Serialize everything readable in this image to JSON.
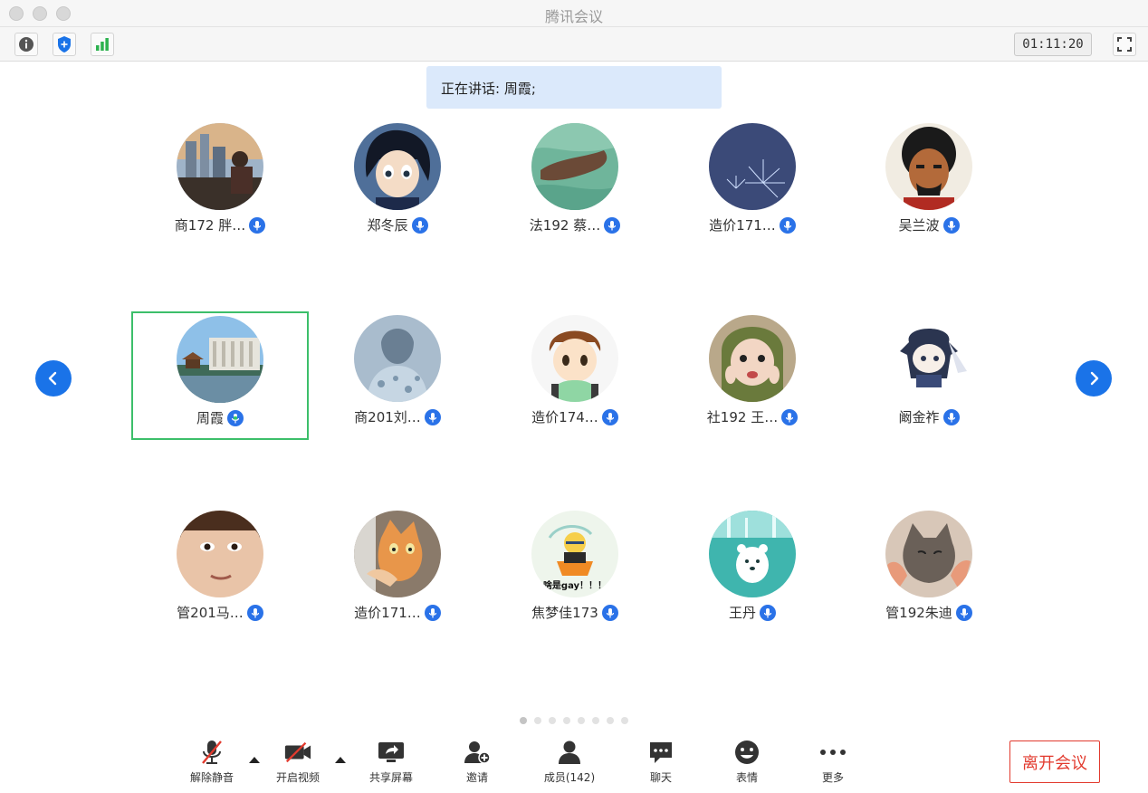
{
  "app": {
    "title": "腾讯会议"
  },
  "toolbar": {
    "timer": "01:11:20"
  },
  "speaking": {
    "label": "正在讲话: 周霞;"
  },
  "participants": [
    {
      "name": "商172 胖…",
      "mic": "blue",
      "active": false
    },
    {
      "name": "郑冬辰",
      "mic": "blue",
      "active": false
    },
    {
      "name": "法192 蔡…",
      "mic": "blue",
      "active": false
    },
    {
      "name": "造价171…",
      "mic": "blue",
      "active": false
    },
    {
      "name": "吴兰波",
      "mic": "blue",
      "active": false
    },
    {
      "name": "周霞",
      "mic": "speaking",
      "active": true
    },
    {
      "name": "商201刘…",
      "mic": "blue",
      "active": false
    },
    {
      "name": "造价174…",
      "mic": "blue",
      "active": false
    },
    {
      "name": "社192 王…",
      "mic": "blue",
      "active": false
    },
    {
      "name": "阚金祚",
      "mic": "blue",
      "active": false
    },
    {
      "name": "管201马…",
      "mic": "blue",
      "active": false
    },
    {
      "name": "造价171…",
      "mic": "blue",
      "active": false
    },
    {
      "name": "焦梦佳173",
      "mic": "blue",
      "active": false
    },
    {
      "name": "王丹",
      "mic": "blue",
      "active": false
    },
    {
      "name": "管192朱迪",
      "mic": "blue",
      "active": false
    }
  ],
  "avatar_texts": {
    "naruto_caption": "啥是gay！！！"
  },
  "pagination": {
    "pages": 8,
    "current": 1
  },
  "bottombar": {
    "unmute": "解除静音",
    "video": "开启视频",
    "share": "共享屏幕",
    "invite": "邀请",
    "members": "成员(142)",
    "chat": "聊天",
    "emoji": "表情",
    "more": "更多",
    "leave": "离开会议"
  },
  "colors": {
    "accent": "#1a73e8",
    "active_border": "#3cbf6a",
    "leave": "#e23a2e",
    "banner": "#dbe9fb"
  }
}
